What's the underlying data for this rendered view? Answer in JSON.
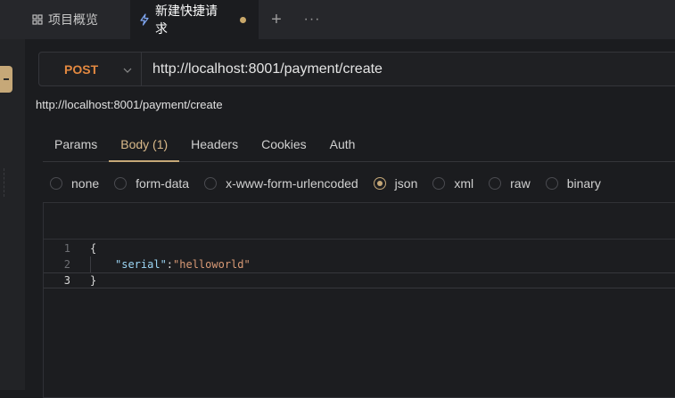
{
  "tabs": [
    {
      "label": "项目概览",
      "icon": "grid-icon"
    },
    {
      "label": "新建快捷请求",
      "icon": "lightning-icon",
      "unsaved": true
    }
  ],
  "tabbar": {
    "add_label": "+",
    "more_label": "···"
  },
  "request": {
    "method": "POST",
    "url": "http://localhost:8001/payment/create",
    "url_preview": "http://localhost:8001/payment/create"
  },
  "subtabs": [
    "Params",
    "Body (1)",
    "Headers",
    "Cookies",
    "Auth"
  ],
  "active_subtab": "Body (1)",
  "body_types": [
    "none",
    "form-data",
    "x-www-form-urlencoded",
    "json",
    "xml",
    "raw",
    "binary"
  ],
  "selected_body_type": "json",
  "editor": {
    "lines": [
      {
        "num": "1",
        "open": "{"
      },
      {
        "num": "2",
        "key": "\"serial\"",
        "colon": ":",
        "value": "\"helloworld\""
      },
      {
        "num": "3",
        "close": "}"
      }
    ]
  },
  "colors": {
    "accent": "#c6a878",
    "method": "#e28840",
    "json_key": "#9cd6f5",
    "json_string": "#d99a76"
  }
}
